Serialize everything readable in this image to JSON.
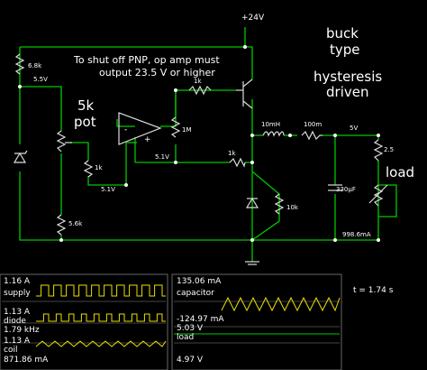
{
  "circuit": {
    "supply_label": "+24V",
    "title_line1": "buck",
    "title_line2": "type",
    "subtitle_line1": "hysteresis",
    "subtitle_line2": "driven",
    "note_line1": "To shut off PNP, op amp must",
    "note_line2": "output 23.5 V or higher",
    "r_6k8": "6.8k",
    "v_5_5": "5.5V",
    "pot_line1": "5k",
    "pot_line2": "pot",
    "r_1k_top": "1k",
    "r_1m": "1M",
    "r_1k_left": "1k",
    "v_5_1_left": "5.1V",
    "v_5_1_mid": "5.1V",
    "r_1k_fb": "1k",
    "r_5k6": "5.6k",
    "inductor": "10mH",
    "r_100m": "100m",
    "v_out": "5V",
    "r_2_5": "2.5",
    "cap": "330µF",
    "r_10k": "10k",
    "load_label": "load",
    "current": "998.6mA",
    "opamp_minus": "-",
    "opamp_plus": "+"
  },
  "scopes": {
    "scope1": {
      "top_value": "1.16 A",
      "name1": "supply",
      "mid_value": "1.13 A",
      "name2": "diode",
      "freq": "1.79 kHz",
      "bottom_value": "1.13 A",
      "name3": "coil",
      "footer": "871.86 mA"
    },
    "scope2": {
      "top_value": "135.06 mA",
      "name1": "capacitor",
      "mid_value": "-124.97 mA",
      "voltage": "5.03 V",
      "name2": "load",
      "footer": "4.97 V"
    },
    "time": "t = 1.74 s",
    "wave_color": "#e8e000",
    "wire_color": "#00cc00"
  }
}
